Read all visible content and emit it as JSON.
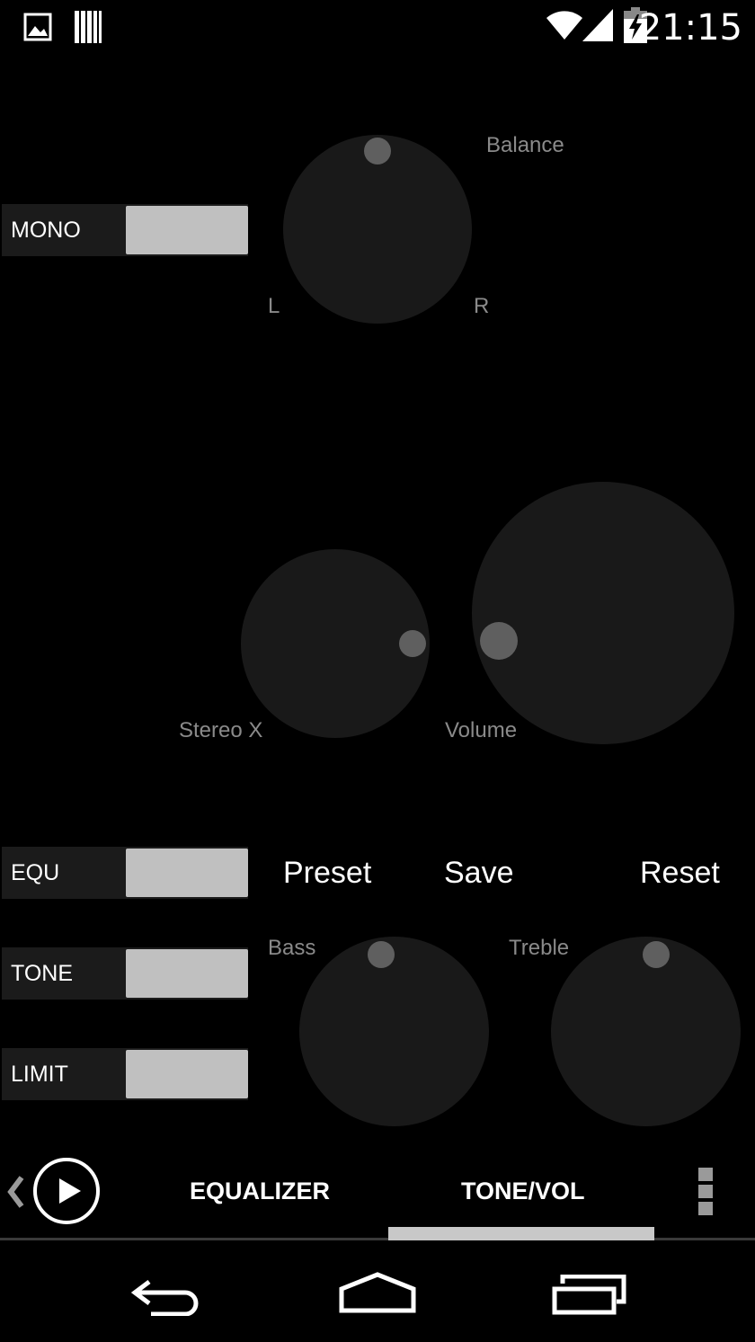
{
  "status_bar": {
    "time": "21:15",
    "icons": [
      "image-icon",
      "barcode-icon",
      "wifi-icon",
      "signal-icon",
      "battery-charging-icon"
    ]
  },
  "controls": {
    "mono": {
      "label": "MONO"
    },
    "equ": {
      "label": "EQU"
    },
    "tone": {
      "label": "TONE"
    },
    "limit": {
      "label": "LIMIT"
    }
  },
  "knobs": {
    "balance": {
      "label": "Balance",
      "left_label": "L",
      "right_label": "R"
    },
    "stereo_x": {
      "label": "Stereo X"
    },
    "volume": {
      "label": "Volume"
    },
    "bass": {
      "label": "Bass"
    },
    "treble": {
      "label": "Treble"
    }
  },
  "actions": {
    "preset": "Preset",
    "save": "Save",
    "reset": "Reset"
  },
  "tabs": [
    {
      "label": "EQUALIZER",
      "selected": false
    },
    {
      "label": "TONE/VOL",
      "selected": true
    }
  ],
  "colors": {
    "background": "#000000",
    "knob": "#191919",
    "knob_indicator": "#5f5f5f",
    "toggle_off": "#c0c0c0",
    "label_gray": "#8a8a8a",
    "tab_indicator": "#c8c8c8"
  }
}
